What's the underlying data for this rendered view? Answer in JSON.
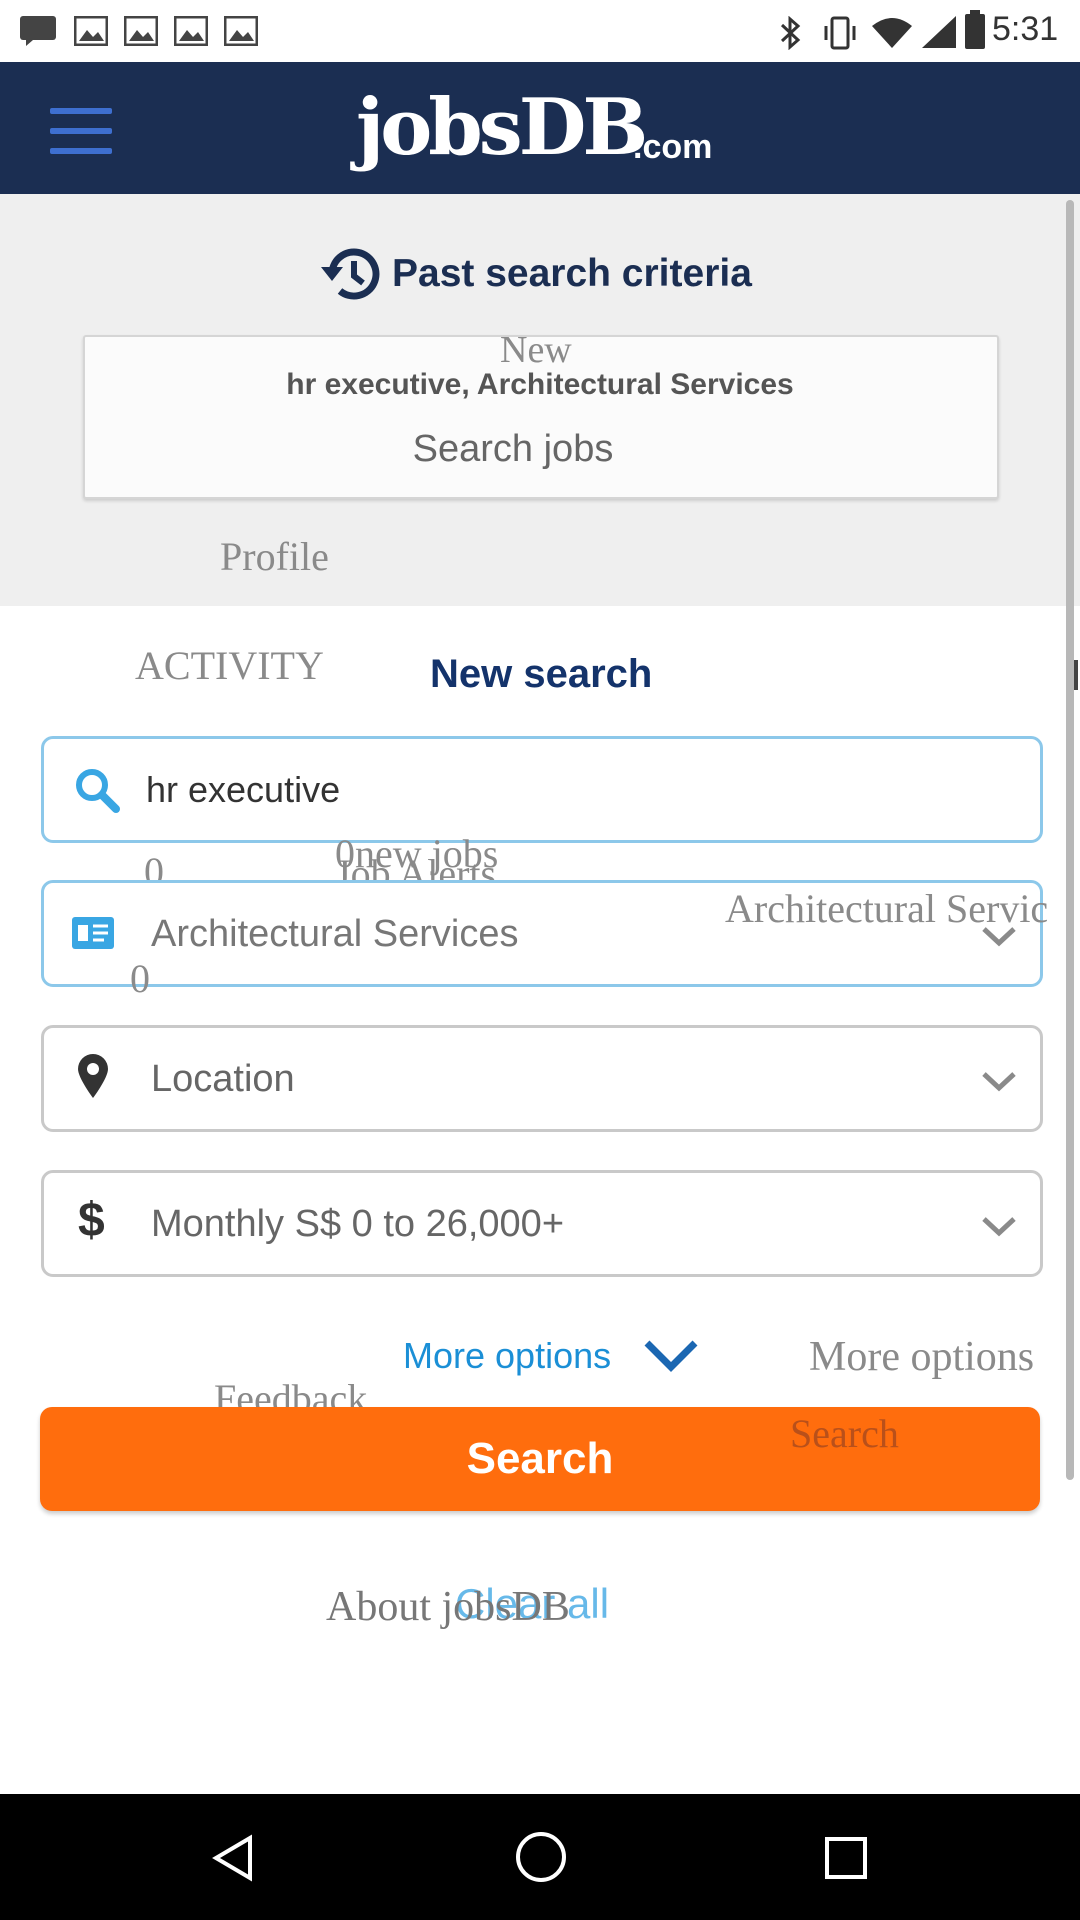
{
  "status_bar": {
    "time": "5:31"
  },
  "app_bar": {
    "logo_text_main": "jobsDB",
    "logo_text_suffix": ".com",
    "menu_icon": "hamburger-icon"
  },
  "past_search": {
    "heading": "Past search criteria",
    "card_new_label": "New",
    "card_criteria": "hr executive, Architectural Services",
    "card_action": "Search jobs"
  },
  "overlay_text": {
    "profile": "Profile",
    "activity": "ACTIVITY",
    "zero_1": "0",
    "zero_2": "0",
    "zero_3": "0",
    "new_jobs": "new jobs",
    "new_jobs_zero": "0",
    "job_alerts": "Job Alerts",
    "architectural_right": "Architectural Servic",
    "more_options_right": "More options",
    "feedback": "Feedback",
    "search_ghost": "Search",
    "about": "About jobsDB",
    "clear_all": "Clear all"
  },
  "new_search": {
    "title": "New search",
    "keyword_value": "hr executive",
    "classification_value": "Architectural Services",
    "location_placeholder": "Location",
    "salary_value": "Monthly S$ 0 to 26,000+",
    "more_options_label": "More options",
    "search_button": "Search"
  },
  "colors": {
    "appbar": "#1b2e52",
    "accent_blue": "#1b67b2",
    "orange": "#ff6d0d",
    "field_border_active": "#8cc8ea"
  }
}
